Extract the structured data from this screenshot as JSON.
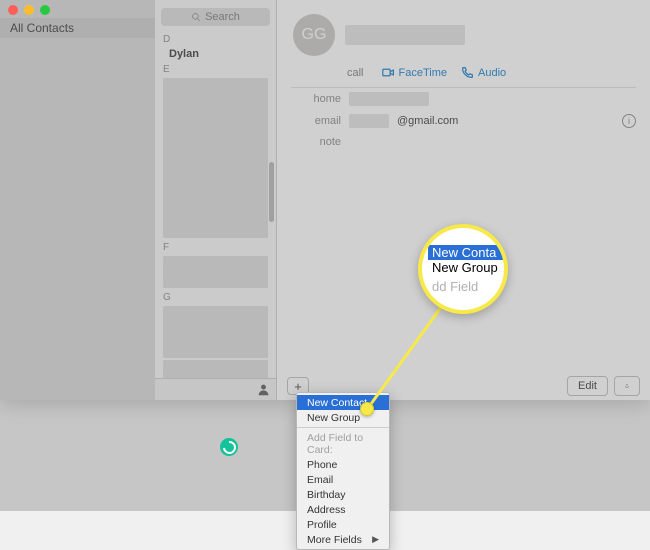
{
  "traffic_lights": {
    "close": "close",
    "min": "minimize",
    "max": "maximize"
  },
  "sidebar": {
    "all_contacts": "All Contacts"
  },
  "search": {
    "placeholder": "Search"
  },
  "sections": {
    "d": "D",
    "dylan": "Dylan",
    "e": "E",
    "f": "F",
    "g": "G"
  },
  "detail": {
    "initials": "GG",
    "call_label": "call",
    "facetime": "FaceTime",
    "audio": "Audio",
    "home_label": "home",
    "email_label": "email",
    "email_suffix": "@gmail.com",
    "note_label": "note",
    "edit": "Edit"
  },
  "menu": {
    "new_contact": "New Contact",
    "new_group": "New Group",
    "add_field_header": "Add Field to Card:",
    "phone": "Phone",
    "email": "Email",
    "birthday": "Birthday",
    "address": "Address",
    "profile": "Profile",
    "more_fields": "More Fields"
  },
  "magnifier": {
    "row1": "New Conta",
    "row2": "New Group",
    "row3": "dd Field"
  }
}
